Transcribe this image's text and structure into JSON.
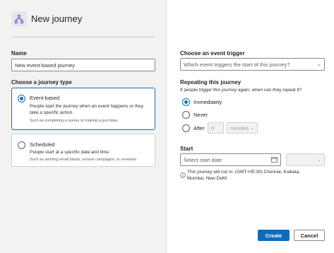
{
  "header": {
    "title": "New journey",
    "icon": "journey-icon"
  },
  "name_field": {
    "label": "Name",
    "value": "New event-based journey"
  },
  "journey_type": {
    "label": "Choose a journey type",
    "options": [
      {
        "title": "Event-based",
        "description": "People start the journey when an event happens or they take a specific action.",
        "hint": "Such as completing a survey or making a purchase",
        "selected": true
      },
      {
        "title": "Scheduled",
        "description": "People start at a specific date and time.",
        "hint": "Such as sending email blasts, nurture campaigns, or renewals",
        "selected": false
      }
    ]
  },
  "trigger": {
    "label": "Choose an event trigger",
    "placeholder": "Which event triggers the start of this journey?"
  },
  "repeat": {
    "label": "Repeating this journey",
    "question": "If people trigger this journey again, when can they repeat it?",
    "options": [
      "Immediately",
      "Never",
      "After"
    ],
    "selected": "Immediately",
    "after_value": "0",
    "after_unit": "minutes"
  },
  "start": {
    "label": "Start",
    "date_placeholder": "Select start date",
    "timezone_note": "This journey will run in: (GMT+05:30) Chennai, Kolkata, Mumbai, New Delhi"
  },
  "footer": {
    "create_label": "Create",
    "cancel_label": "Cancel"
  },
  "colors": {
    "accent": "#0f6cbd",
    "left_bg": "#f3f2f1"
  }
}
